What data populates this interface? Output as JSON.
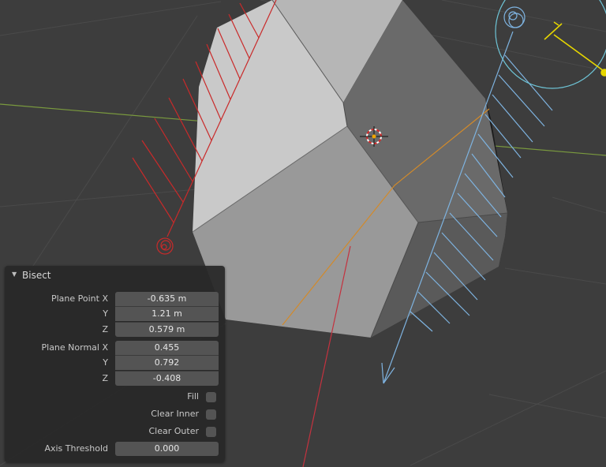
{
  "panel": {
    "title": "Bisect",
    "plane_point": {
      "label_x": "Plane Point X",
      "label_y": "Y",
      "label_z": "Z",
      "x": "-0.635 m",
      "y": "1.21 m",
      "z": "0.579 m"
    },
    "plane_normal": {
      "label_x": "Plane Normal X",
      "label_y": "Y",
      "label_z": "Z",
      "x": "0.455",
      "y": "0.792",
      "z": "-0.408"
    },
    "fill": {
      "label": "Fill",
      "checked": false
    },
    "clear_inner": {
      "label": "Clear Inner",
      "checked": false
    },
    "clear_outer": {
      "label": "Clear Outer",
      "checked": false
    },
    "axis_threshold": {
      "label": "Axis Threshold",
      "value": "0.000"
    }
  },
  "colors": {
    "viewport_bg": "#3d3d3d",
    "x_axis": "#c4323f",
    "y_axis": "#8bb24a",
    "gizmo_blue": "#7eb3e0",
    "gizmo_red": "#c92a2a",
    "light_yellow": "#e6d600",
    "cut_line": "#e08a1c"
  }
}
